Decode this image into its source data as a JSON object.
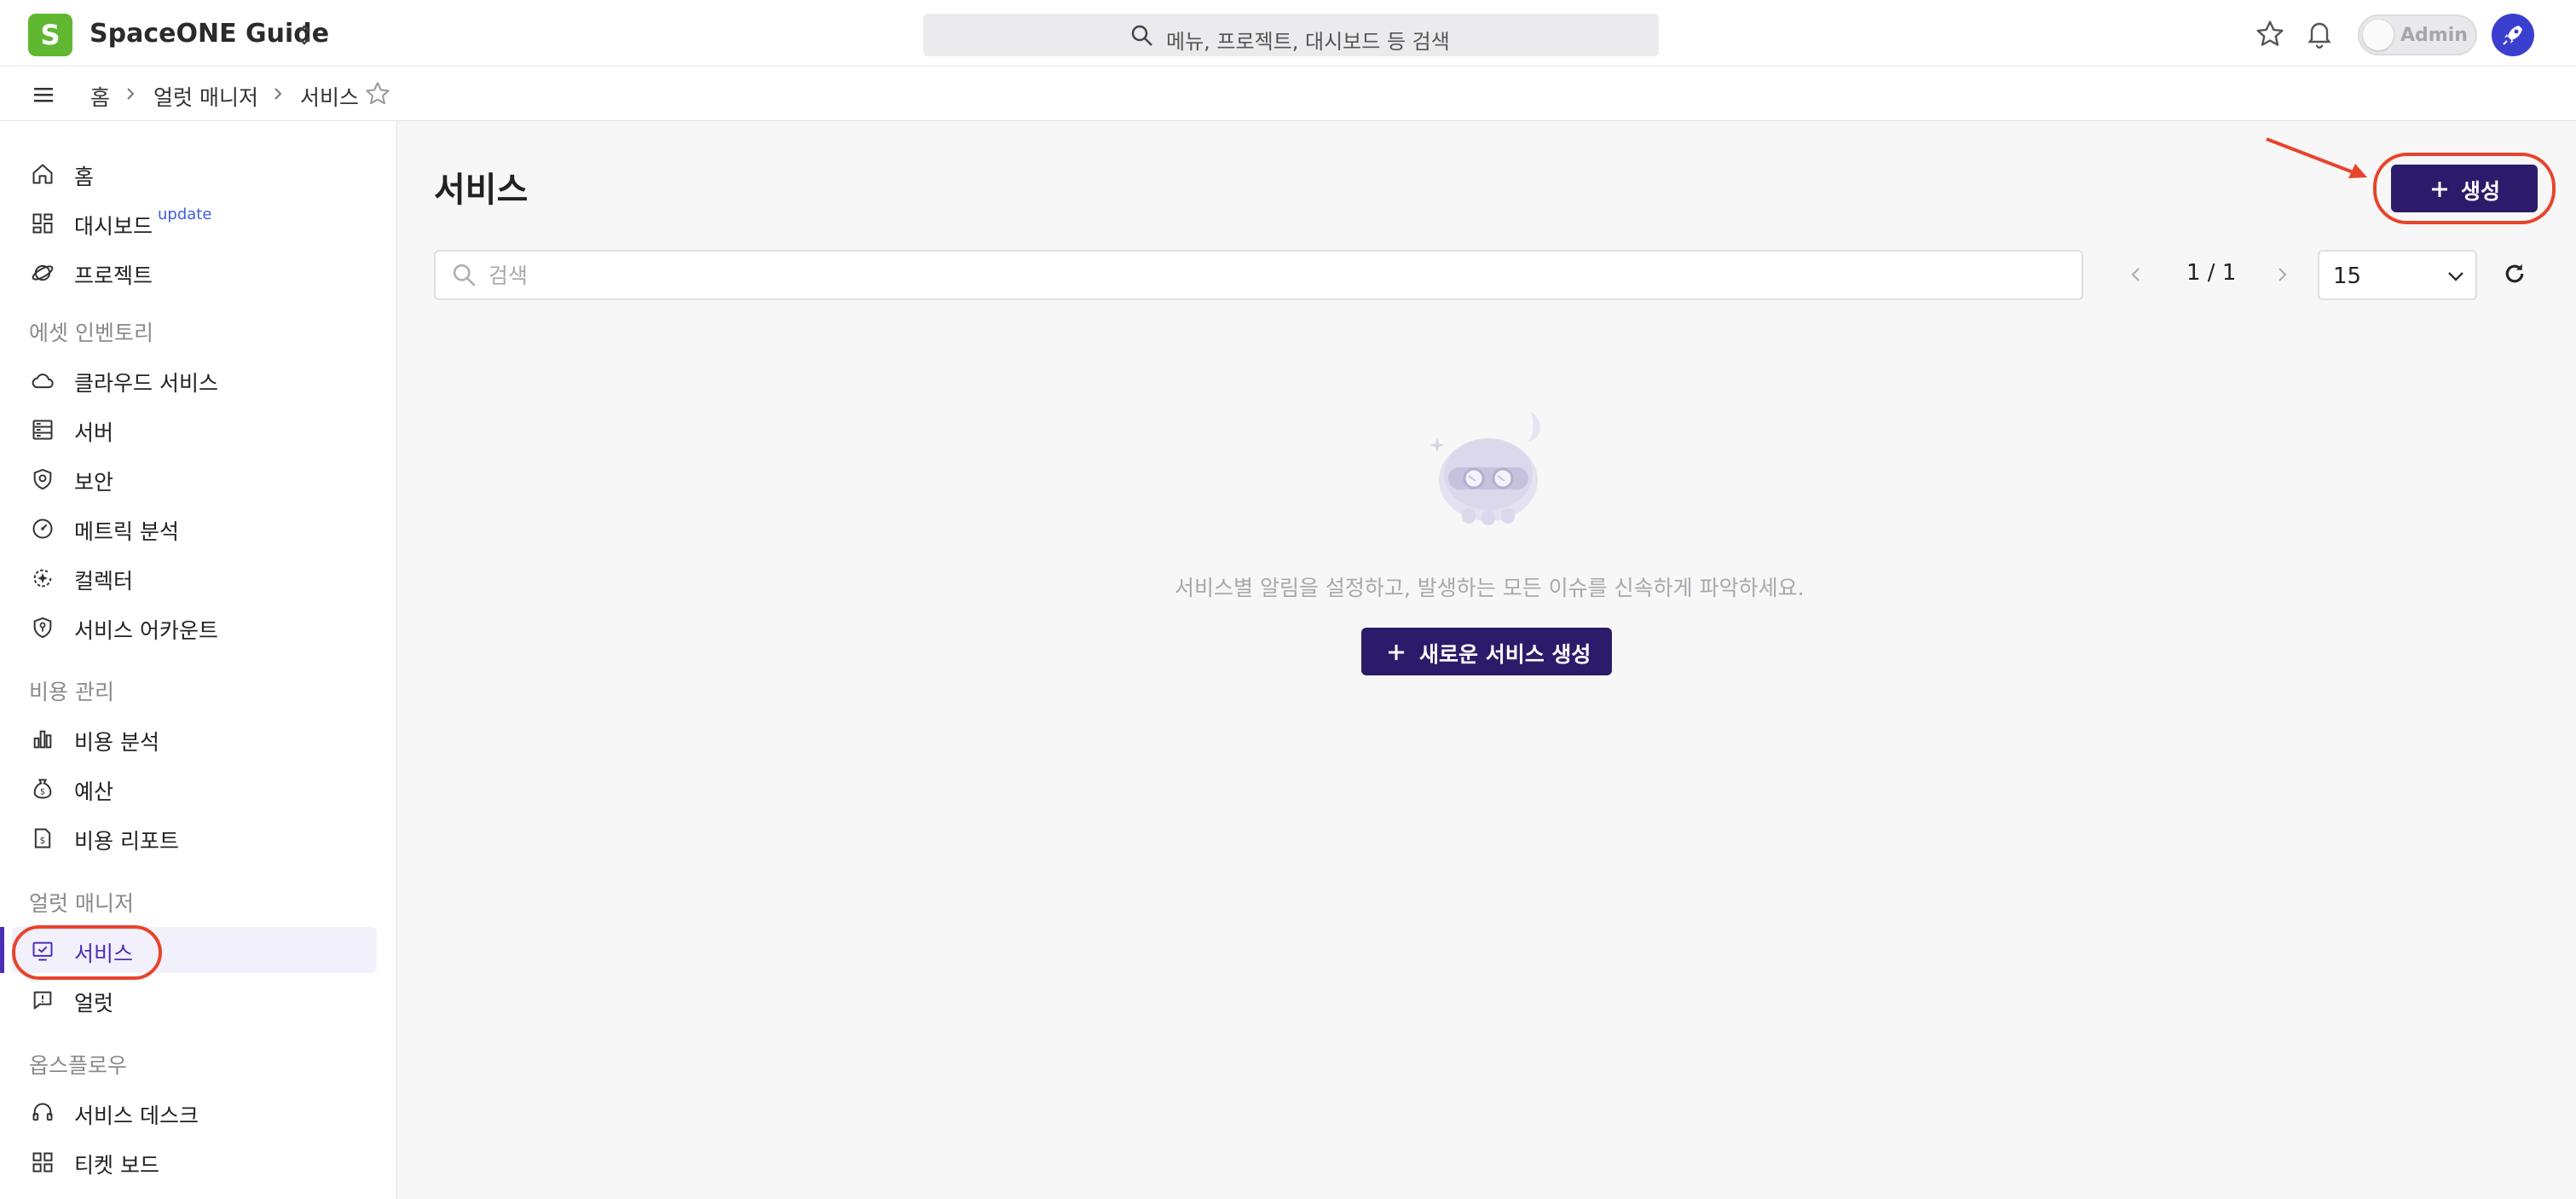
{
  "gnb": {
    "logo_letter": "S",
    "workspace_name": "SpaceONE Guide",
    "search_placeholder": "메뉴, 프로젝트, 대시보드 등 검색",
    "admin_label": "Admin"
  },
  "breadcrumb": {
    "items": [
      "홈",
      "얼럿 매니저",
      "서비스"
    ]
  },
  "sidebar": {
    "top_items": [
      {
        "label": "홈",
        "icon": "home-icon"
      },
      {
        "label": "대시보드",
        "icon": "dashboard-icon",
        "badge": "update"
      },
      {
        "label": "프로젝트",
        "icon": "project-icon"
      }
    ],
    "sections": [
      {
        "title": "에셋 인벤토리",
        "items": [
          "클라우드 서비스",
          "서버",
          "보안",
          "메트릭 분석",
          "컬렉터",
          "서비스 어카운트"
        ]
      },
      {
        "title": "비용 관리",
        "items": [
          "비용 분석",
          "예산",
          "비용 리포트"
        ]
      },
      {
        "title": "얼럿 매니저",
        "items": [
          "서비스",
          "얼럿"
        ]
      },
      {
        "title": "옵스플로우",
        "items": [
          "서비스 데스크",
          "티켓 보드"
        ]
      }
    ],
    "active_item": "서비스"
  },
  "main": {
    "title": "서비스",
    "create_label": "생성",
    "search_placeholder": "검색",
    "pagination": "1 / 1",
    "page_size": "15",
    "empty_message": "서비스별 알림을 설정하고, 발생하는 모든 이슈를 신속하게 파악하세요.",
    "new_service_label": "새로운 서비스 생성"
  },
  "colors": {
    "primary": "#2c1b6b",
    "accent": "#4b2fb5",
    "annotation": "#e8432c",
    "logo": "#60b731"
  }
}
